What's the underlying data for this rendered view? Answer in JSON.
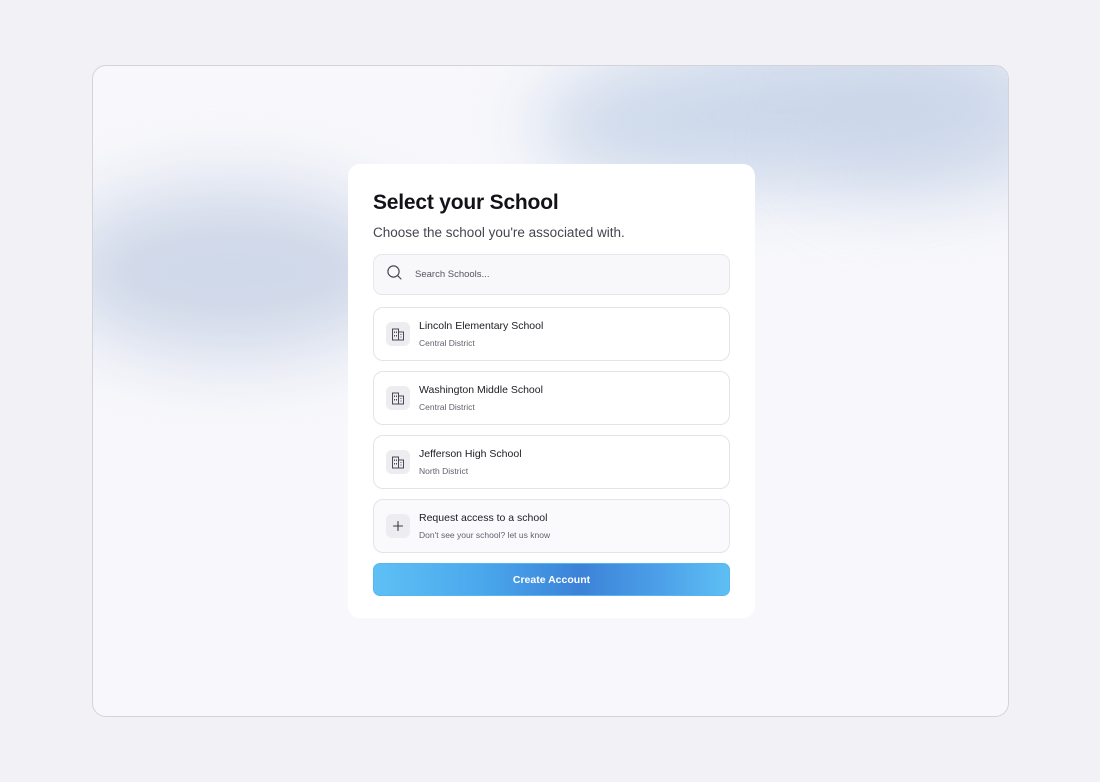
{
  "page": {
    "title": "Select your School",
    "subtitle": "Choose the school you're associated with."
  },
  "search": {
    "placeholder": "Search Schools...",
    "icon": "search-icon"
  },
  "schools": [
    {
      "name": "Lincoln Elementary School",
      "district": "Central District",
      "icon": "building-icon"
    },
    {
      "name": "Washington Middle School",
      "district": "Central District",
      "icon": "building-icon"
    },
    {
      "name": "Jefferson High School",
      "district": "North District",
      "icon": "building-icon"
    }
  ],
  "request": {
    "title": "Request access to a school",
    "subtitle": "Don't see your school? let us know",
    "icon": "plus-icon"
  },
  "create_button": {
    "label": "Create Account"
  },
  "colors": {
    "background": "#f1f1f6",
    "card": "#ffffff",
    "accent_light": "#5ec0f5",
    "accent_dark": "#3c82d8"
  }
}
